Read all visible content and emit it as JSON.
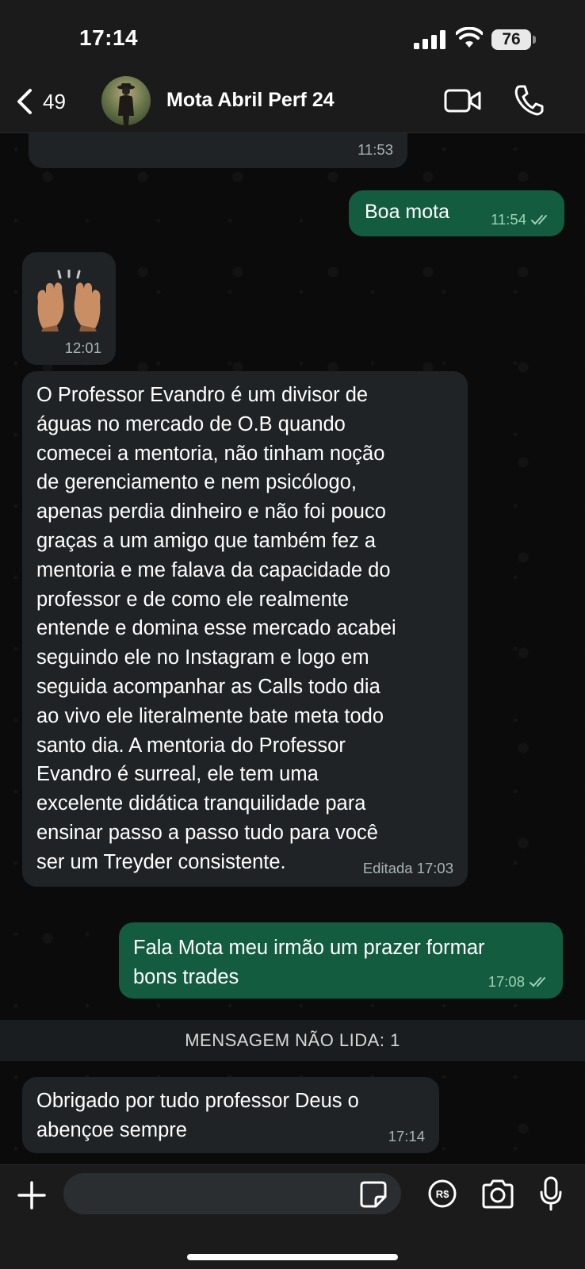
{
  "status_bar": {
    "time": "17:14",
    "battery": "76"
  },
  "header": {
    "back_count": "49",
    "contact_name": "Mota Abril Perf 24"
  },
  "messages": [
    {
      "id": "partial",
      "direction": "in",
      "time": "11:53"
    },
    {
      "id": "boa",
      "direction": "out",
      "text": "Boa mota",
      "time": "11:54",
      "status": "read"
    },
    {
      "id": "emoji",
      "direction": "in",
      "emoji": "raising-hands-medium-skin-tone",
      "time": "12:01"
    },
    {
      "id": "long",
      "direction": "in",
      "text": "O Professor Evandro é um divisor de\náguas no mercado de O.B quando\ncomecei a mentoria, não tinham noção\nde gerenciamento e nem  psicólogo,\napenas perdia  dinheiro e não foi pouco\ngraças a um amigo que também fez a\nmentoria e me falava da capacidade do\nprofessor e de como ele realmente\nentende e domina esse mercado acabei\nseguindo ele no Instagram e logo em\nseguida acompanhar as Calls todo dia\nao vivo ele  literalmente bate meta todo\nsanto dia. A mentoria do Professor\nEvandro é surreal, ele tem uma\nexcelente didática tranquilidade para\nensinar passo a passo tudo para você\nser um Treyder consistente.",
      "time": "Editada 17:03"
    },
    {
      "id": "fala",
      "direction": "out",
      "text": "Fala Mota meu irmão um prazer formar\nbons trades",
      "time": "17:08",
      "status": "read"
    },
    {
      "id": "obrigado",
      "direction": "in",
      "text": "Obrigado por tudo professor Deus o\nabençoe sempre",
      "time": "17:14"
    }
  ],
  "unread_banner": "MENSAGEM NÃO LIDA: 1",
  "colors": {
    "incoming_bubble": "#1f2326",
    "outgoing_bubble": "#135c40",
    "background": "#0b0b0b",
    "bars": "#1b1b1b"
  },
  "input_bar": {
    "icons": [
      "plus-icon",
      "sticker-icon",
      "rs-payment-icon",
      "camera-icon",
      "microphone-icon"
    ]
  }
}
